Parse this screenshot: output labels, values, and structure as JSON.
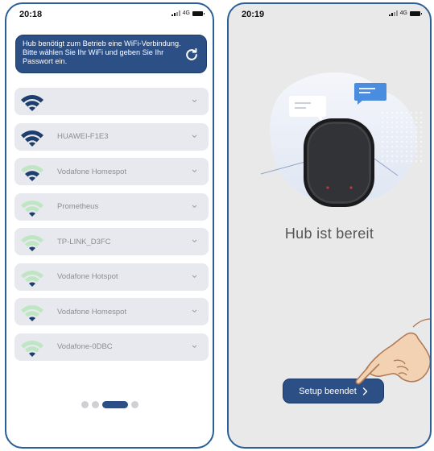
{
  "left_screen": {
    "status": {
      "time": "20:18",
      "network": "4G"
    },
    "notice": {
      "text": "Hub benötigt zum Betrieb eine WiFi-Verbindung. Bitte wählen Sie Ihr WiFi und geben Sie Ihr Passwort ein.",
      "refresh_icon": "refresh-icon"
    },
    "networks": [
      {
        "name": "",
        "strength": 3
      },
      {
        "name": "HUAWEI-F1E3",
        "strength": 3
      },
      {
        "name": "Vodafone Homespot",
        "strength": 2
      },
      {
        "name": "Prometheus",
        "strength": 1
      },
      {
        "name": "TP-LINK_D3FC",
        "strength": 1
      },
      {
        "name": "Vodafone Hotspot",
        "strength": 1
      },
      {
        "name": "Vodafone Homespot",
        "strength": 1
      },
      {
        "name": "Vodafone-0DBC",
        "strength": 1
      }
    ],
    "pager": {
      "total": 4,
      "active": 3
    }
  },
  "right_screen": {
    "status": {
      "time": "20:19",
      "network": "4G"
    },
    "title": "Hub ist bereit",
    "button": {
      "label": "Setup beendet",
      "icon": "chevron-right-icon"
    }
  },
  "colors": {
    "primary": "#2c4f86",
    "wifi_on": "#1e3f6e",
    "wifi_off": "#bfe6c3",
    "item_bg": "#e8e9ee"
  }
}
